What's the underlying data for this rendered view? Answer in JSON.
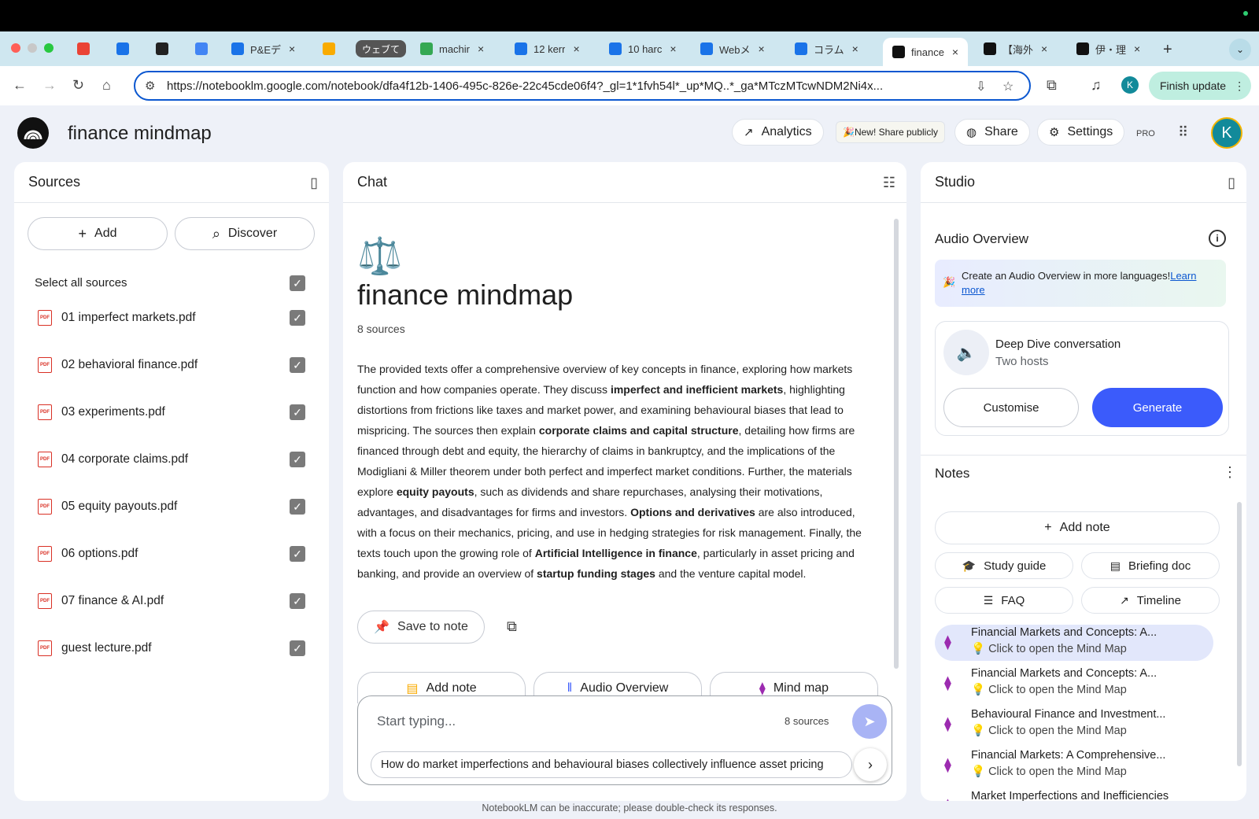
{
  "browser": {
    "tabs": [
      {
        "label": "",
        "icon": "gmail-icon",
        "color": "#ea4335"
      },
      {
        "label": "",
        "icon": "calendar-icon",
        "color": "#1a73e8"
      },
      {
        "label": "",
        "icon": "openai-icon",
        "color": "#222222"
      },
      {
        "label": "",
        "icon": "gemini-icon",
        "color": "#4285f4"
      },
      {
        "label": "P&Eデ",
        "icon": "docs-icon",
        "color": "#1a73e8"
      },
      {
        "label": "",
        "icon": "yellow-app-icon",
        "color": "#f9ab00"
      },
      {
        "label": "ウェブて",
        "icon": "",
        "color": "#555555"
      },
      {
        "label": "machir",
        "icon": "drive-icon",
        "color": "#34a853"
      },
      {
        "label": "12 kerr",
        "icon": "docs-icon",
        "color": "#1a73e8"
      },
      {
        "label": "10 harc",
        "icon": "docs-icon",
        "color": "#1a73e8"
      },
      {
        "label": "Webメ",
        "icon": "docs-icon",
        "color": "#1a73e8"
      },
      {
        "label": "コラム",
        "icon": "docs-icon",
        "color": "#1a73e8"
      },
      {
        "label": "finance",
        "icon": "notebooklm-icon",
        "color": "#111111"
      },
      {
        "label": "【海外",
        "icon": "notion-icon",
        "color": "#111111"
      },
      {
        "label": "伊・理",
        "icon": "notion-icon",
        "color": "#111111"
      }
    ],
    "url": "https://notebooklm.google.com/notebook/dfa4f12b-1406-495c-826e-22c45cde06f4?_gl=1*1fvh54l*_up*MQ..*_ga*MTczMTcwNDM2Ni4x...",
    "profile_initial": "K",
    "finish_update": "Finish update"
  },
  "header": {
    "title": "finance mindmap",
    "analytics": "Analytics",
    "share_publicly": "🎉New! Share publicly",
    "share": "Share",
    "settings": "Settings",
    "pro": "PRO",
    "avatar_initial": "K"
  },
  "sources": {
    "title": "Sources",
    "add": "Add",
    "discover": "Discover",
    "select_all": "Select all sources",
    "items": [
      "01 imperfect markets.pdf",
      "02 behavioral finance.pdf",
      "03 experiments.pdf",
      "04 corporate claims.pdf",
      "05 equity payouts.pdf",
      "06 options.pdf",
      "07 finance & AI.pdf",
      "guest lecture.pdf"
    ]
  },
  "chat": {
    "title": "Chat",
    "emoji": "⚖️",
    "notebook_title": "finance mindmap",
    "source_count": "8 sources",
    "summary_parts": [
      {
        "t": "The provided texts offer a comprehensive overview of key concepts in finance, exploring how markets function and how companies operate. They discuss ",
        "b": false
      },
      {
        "t": "imperfect and inefficient markets",
        "b": true
      },
      {
        "t": ", highlighting distortions from frictions like taxes and market power, and examining behavioural biases that lead to mispricing. The sources then explain ",
        "b": false
      },
      {
        "t": "corporate claims and capital structure",
        "b": true
      },
      {
        "t": ", detailing how firms are financed through debt and equity, the hierarchy of claims in bankruptcy, and the implications of the Modigliani & Miller theorem under both perfect and imperfect market conditions. Further, the materials explore ",
        "b": false
      },
      {
        "t": "equity payouts",
        "b": true
      },
      {
        "t": ", such as dividends and share repurchases, analysing their motivations, advantages, and disadvantages for firms and investors. ",
        "b": false
      },
      {
        "t": "Options and derivatives",
        "b": true
      },
      {
        "t": " are also introduced, with a focus on their mechanics, pricing, and use in hedging strategies for risk management. Finally, the texts touch upon the growing role of ",
        "b": false
      },
      {
        "t": "Artificial Intelligence in finance",
        "b": true
      },
      {
        "t": ", particularly in asset pricing and banking, and provide an overview of ",
        "b": false
      },
      {
        "t": "startup funding stages",
        "b": true
      },
      {
        "t": " and the venture capital model.",
        "b": false
      }
    ],
    "save_to_note": "Save to note",
    "chips": [
      "Add note",
      "Audio Overview",
      "Mind map"
    ],
    "input_placeholder": "Start typing...",
    "input_sources": "8 sources",
    "suggestion": "How do market imperfections and behavioural biases collectively influence asset pricing",
    "disclaimer": "NotebookLM can be inaccurate; please double-check its responses."
  },
  "studio": {
    "title": "Studio",
    "audio_overview": "Audio Overview",
    "promo_text": "Create an Audio Overview in more languages!",
    "promo_link": "Learn more",
    "deep_dive_title": "Deep Dive conversation",
    "deep_dive_sub": "Two hosts",
    "customise": "Customise",
    "generate": "Generate",
    "notes_title": "Notes",
    "add_note": "Add note",
    "note_buttons": [
      "Study guide",
      "Briefing doc",
      "FAQ",
      "Timeline"
    ],
    "notes": [
      {
        "title": "Financial Markets and Concepts: A...",
        "sub": "💡 Click to open the Mind Map"
      },
      {
        "title": "Financial Markets and Concepts: A...",
        "sub": "💡 Click to open the Mind Map"
      },
      {
        "title": "Behavioural Finance and Investment...",
        "sub": "💡 Click to open the Mind Map"
      },
      {
        "title": "Financial Markets: A Comprehensive...",
        "sub": "💡 Click to open the Mind Map"
      },
      {
        "title": "Market Imperfections and Inefficiencies",
        "sub": ""
      }
    ]
  },
  "colors": {
    "primary": "#3b5bfb",
    "pdf_red": "#d93025",
    "mindmap_purple": "#9c2bb0"
  }
}
